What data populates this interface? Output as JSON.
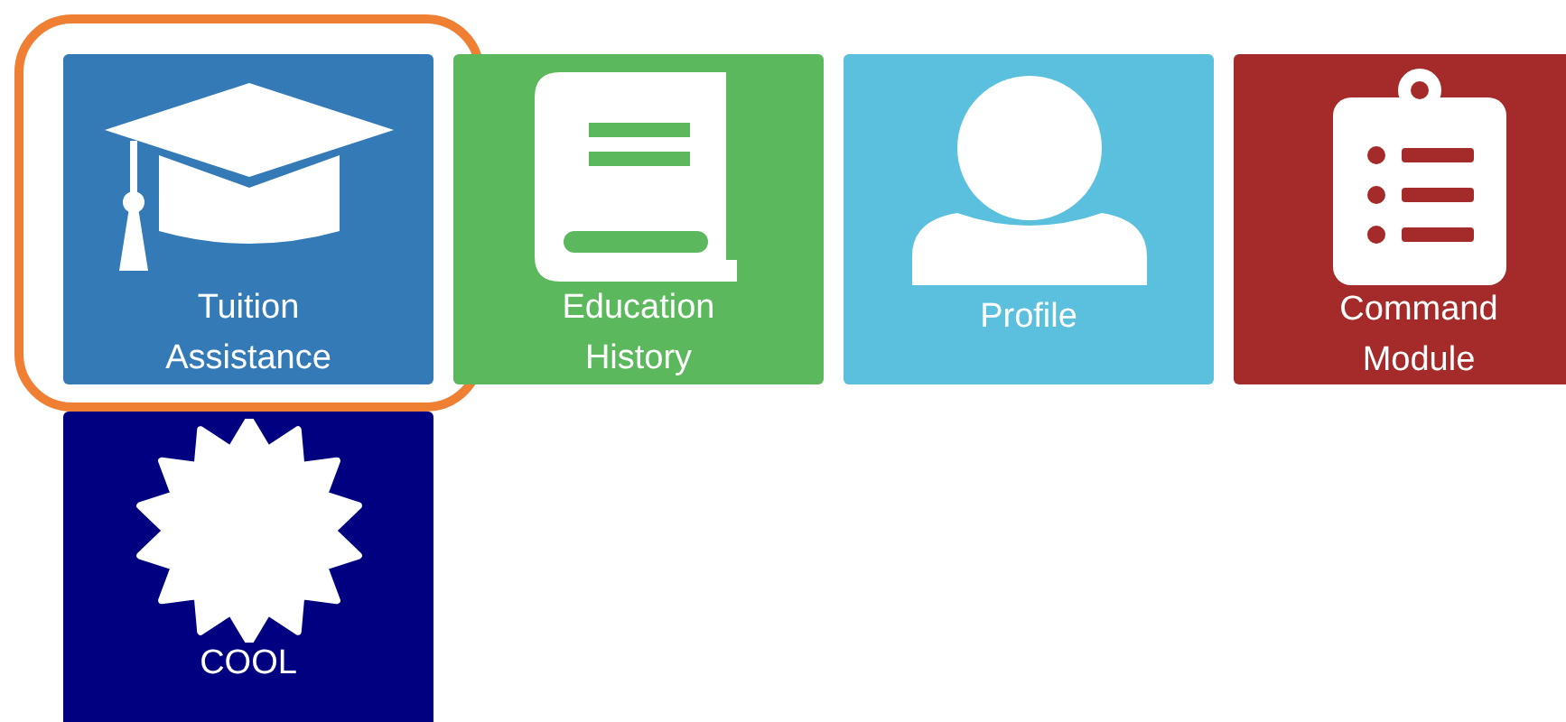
{
  "tiles": [
    {
      "kind": "cap",
      "label": "Tuition Assistance",
      "color": "#337ab7",
      "highlighted": true
    },
    {
      "kind": "book",
      "label": "Education History",
      "color": "#5cb85c",
      "highlighted": false
    },
    {
      "kind": "person",
      "label": "Profile",
      "color": "#5bc0de",
      "highlighted": false
    },
    {
      "kind": "clipboard",
      "label": "Command Module",
      "color": "#a52a2a",
      "highlighted": false
    },
    {
      "kind": "star",
      "label": "COOL",
      "color": "#000080",
      "highlighted": false
    }
  ]
}
